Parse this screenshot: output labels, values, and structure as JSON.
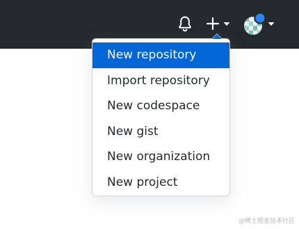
{
  "header": {
    "background": "#24292e",
    "icons": {
      "notifications": "bell-icon",
      "create_new": "plus-icon",
      "create_new_caret": "caret-down-icon",
      "avatar": "avatar",
      "avatar_caret": "caret-down-icon"
    }
  },
  "create_menu": {
    "accent": "#0366d6",
    "items": [
      {
        "label": "New repository",
        "active": true
      },
      {
        "label": "Import repository",
        "active": false
      },
      {
        "label": "New codespace",
        "active": false
      },
      {
        "label": "New gist",
        "active": false
      },
      {
        "label": "New organization",
        "active": false
      },
      {
        "label": "New project",
        "active": false
      }
    ]
  },
  "watermark": "@稀土掘金技术社区"
}
